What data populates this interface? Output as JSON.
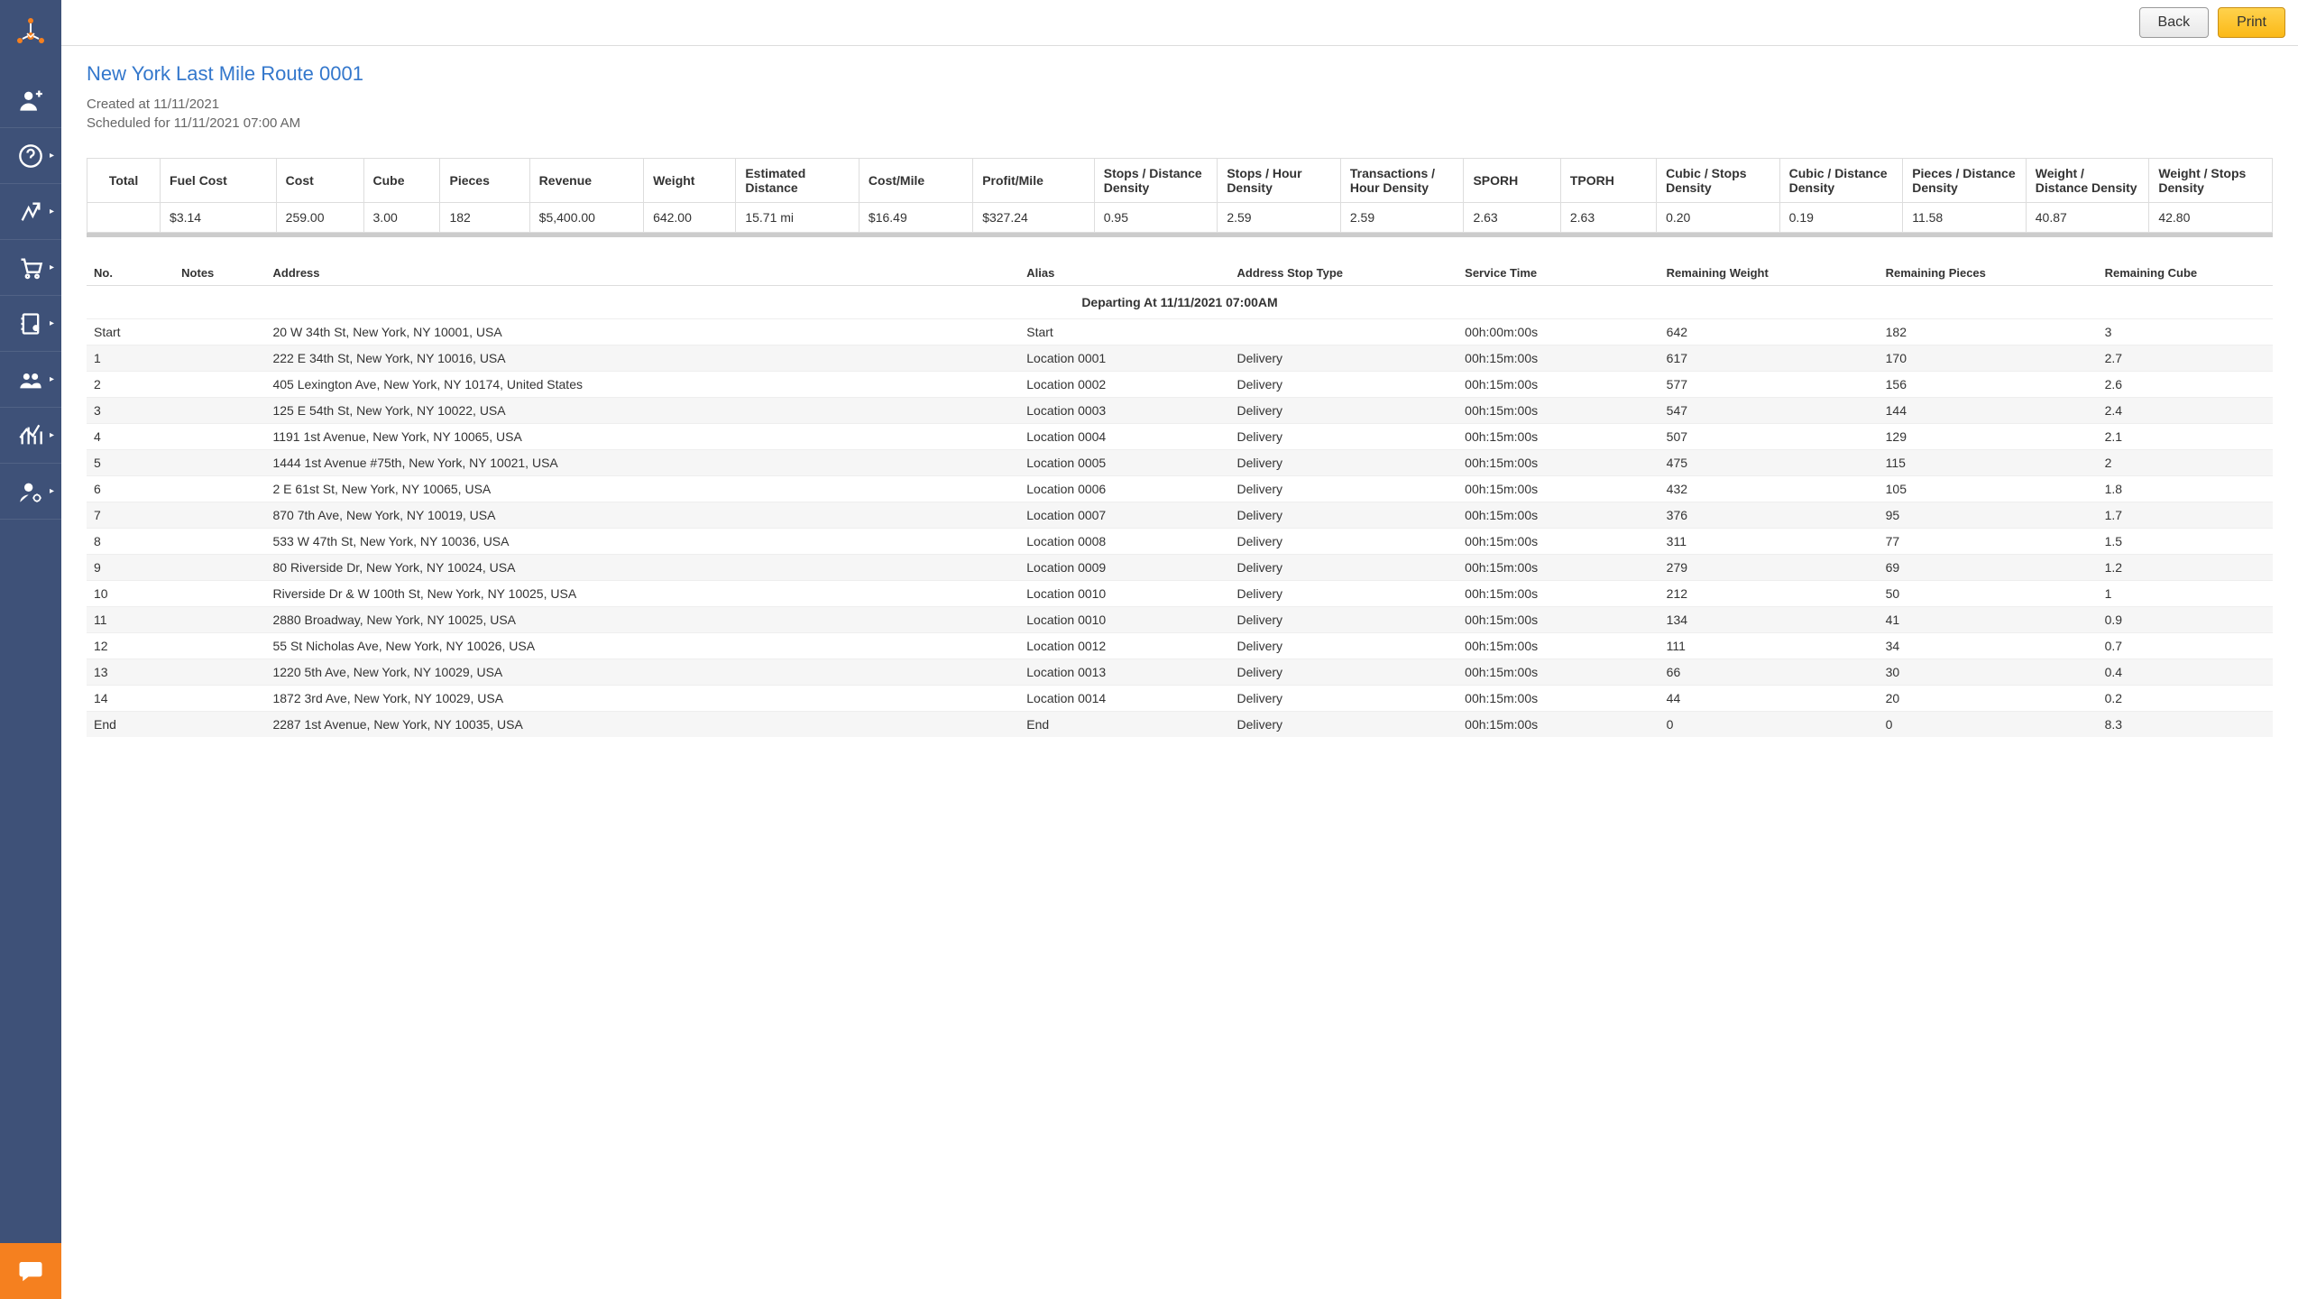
{
  "header": {
    "back_label": "Back",
    "print_label": "Print"
  },
  "page": {
    "title": "New York Last Mile Route 0001",
    "created_at_prefix": "Created at ",
    "created_at": "11/11/2021",
    "scheduled_for_prefix": "Scheduled for ",
    "scheduled_for": "11/11/2021 07:00 AM"
  },
  "summary": {
    "headers": [
      "Total",
      "Fuel Cost",
      "Cost",
      "Cube",
      "Pieces",
      "Revenue",
      "Weight",
      "Estimated Distance",
      "Cost/Mile",
      "Profit/Mile",
      "Stops / Distance Density",
      "Stops / Hour Density",
      "Transactions / Hour Density",
      "SPORH",
      "TPORH",
      "Cubic / Stops Density",
      "Cubic / Distance Density",
      "Pieces / Distance Density",
      "Weight / Distance Density",
      "Weight / Stops Density"
    ],
    "values": [
      "",
      "$3.14",
      "259.00",
      "3.00",
      "182",
      "$5,400.00",
      "642.00",
      "15.71 mi",
      "$16.49",
      "$327.24",
      "0.95",
      "2.59",
      "2.59",
      "2.63",
      "2.63",
      "0.20",
      "0.19",
      "11.58",
      "40.87",
      "42.80"
    ]
  },
  "stops_header": [
    "No.",
    "Notes",
    "Address",
    "Alias",
    "Address Stop Type",
    "Service Time",
    "Remaining Weight",
    "Remaining Pieces",
    "Remaining Cube"
  ],
  "depart_label": "Departing At 11/11/2021 07:00AM",
  "stops": [
    {
      "no": "Start",
      "notes": "",
      "address": "20 W 34th St, New York, NY 10001, USA",
      "alias": "Start",
      "type": "",
      "service": "00h:00m:00s",
      "weight": "642",
      "pieces": "182",
      "cube": "3"
    },
    {
      "no": "1",
      "notes": "",
      "address": "222 E 34th St, New York, NY 10016, USA",
      "alias": "Location 0001",
      "type": "Delivery",
      "service": "00h:15m:00s",
      "weight": "617",
      "pieces": "170",
      "cube": "2.7"
    },
    {
      "no": "2",
      "notes": "",
      "address": "405 Lexington Ave, New York, NY 10174, United States",
      "alias": "Location 0002",
      "type": "Delivery",
      "service": "00h:15m:00s",
      "weight": "577",
      "pieces": "156",
      "cube": "2.6"
    },
    {
      "no": "3",
      "notes": "",
      "address": "125 E 54th St, New York, NY 10022, USA",
      "alias": "Location 0003",
      "type": "Delivery",
      "service": "00h:15m:00s",
      "weight": "547",
      "pieces": "144",
      "cube": "2.4"
    },
    {
      "no": "4",
      "notes": "",
      "address": "1191 1st Avenue, New York, NY 10065, USA",
      "alias": "Location 0004",
      "type": "Delivery",
      "service": "00h:15m:00s",
      "weight": "507",
      "pieces": "129",
      "cube": "2.1"
    },
    {
      "no": "5",
      "notes": "",
      "address": "1444 1st Avenue #75th, New York, NY 10021, USA",
      "alias": "Location 0005",
      "type": "Delivery",
      "service": "00h:15m:00s",
      "weight": "475",
      "pieces": "115",
      "cube": "2"
    },
    {
      "no": "6",
      "notes": "",
      "address": "2 E 61st St, New York, NY 10065, USA",
      "alias": "Location 0006",
      "type": "Delivery",
      "service": "00h:15m:00s",
      "weight": "432",
      "pieces": "105",
      "cube": "1.8"
    },
    {
      "no": "7",
      "notes": "",
      "address": "870 7th Ave, New York, NY 10019, USA",
      "alias": "Location 0007",
      "type": "Delivery",
      "service": "00h:15m:00s",
      "weight": "376",
      "pieces": "95",
      "cube": "1.7"
    },
    {
      "no": "8",
      "notes": "",
      "address": "533 W 47th St, New York, NY 10036, USA",
      "alias": "Location 0008",
      "type": "Delivery",
      "service": "00h:15m:00s",
      "weight": "311",
      "pieces": "77",
      "cube": "1.5"
    },
    {
      "no": "9",
      "notes": "",
      "address": "80 Riverside Dr, New York, NY 10024, USA",
      "alias": "Location 0009",
      "type": "Delivery",
      "service": "00h:15m:00s",
      "weight": "279",
      "pieces": "69",
      "cube": "1.2"
    },
    {
      "no": "10",
      "notes": "",
      "address": "Riverside Dr & W 100th St, New York, NY 10025, USA",
      "alias": "Location 0010",
      "type": "Delivery",
      "service": "00h:15m:00s",
      "weight": "212",
      "pieces": "50",
      "cube": "1"
    },
    {
      "no": "11",
      "notes": "",
      "address": "2880 Broadway, New York, NY 10025, USA",
      "alias": "Location 0010",
      "type": "Delivery",
      "service": "00h:15m:00s",
      "weight": "134",
      "pieces": "41",
      "cube": "0.9"
    },
    {
      "no": "12",
      "notes": "",
      "address": "55 St Nicholas Ave, New York, NY 10026, USA",
      "alias": "Location 0012",
      "type": "Delivery",
      "service": "00h:15m:00s",
      "weight": "111",
      "pieces": "34",
      "cube": "0.7"
    },
    {
      "no": "13",
      "notes": "",
      "address": "1220 5th Ave, New York, NY 10029, USA",
      "alias": "Location 0013",
      "type": "Delivery",
      "service": "00h:15m:00s",
      "weight": "66",
      "pieces": "30",
      "cube": "0.4"
    },
    {
      "no": "14",
      "notes": "",
      "address": "1872 3rd Ave, New York, NY 10029, USA",
      "alias": "Location 0014",
      "type": "Delivery",
      "service": "00h:15m:00s",
      "weight": "44",
      "pieces": "20",
      "cube": "0.2"
    },
    {
      "no": "End",
      "notes": "",
      "address": "2287 1st Avenue, New York, NY 10035, USA",
      "alias": "End",
      "type": "Delivery",
      "service": "00h:15m:00s",
      "weight": "0",
      "pieces": "0",
      "cube": "8.3"
    }
  ]
}
